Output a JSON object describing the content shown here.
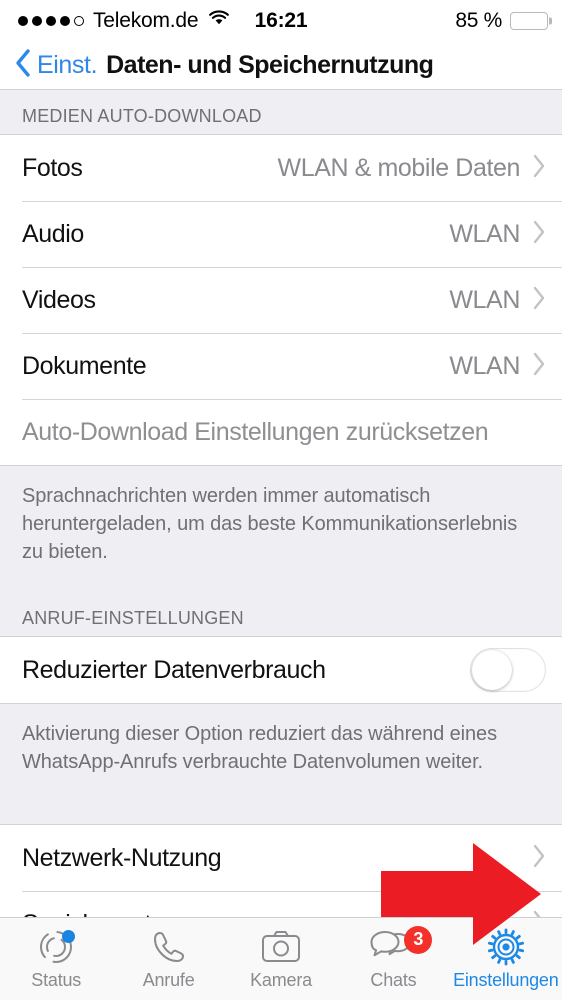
{
  "status_bar": {
    "carrier": "Telekom.de",
    "signal_dots_filled": 4,
    "signal_dots_total": 5,
    "wifi_icon": "wifi-icon",
    "time": "16:21",
    "battery_percent": "85 %",
    "battery_level": 85,
    "battery_color": "#fecb2e"
  },
  "nav": {
    "back_icon": "chevron-left-icon",
    "back_label": "Einst.",
    "title": "Daten- und Speichernutzung",
    "accent_color": "#2f87e8"
  },
  "sections": {
    "media": {
      "header": "MEDIEN AUTO-DOWNLOAD",
      "rows": [
        {
          "label": "Fotos",
          "value": "WLAN & mobile Daten"
        },
        {
          "label": "Audio",
          "value": "WLAN"
        },
        {
          "label": "Videos",
          "value": "WLAN"
        },
        {
          "label": "Dokumente",
          "value": "WLAN"
        }
      ],
      "reset_label": "Auto-Download Einstellungen zurücksetzen",
      "footer": "Sprachnachrichten werden immer automatisch heruntergeladen, um das beste Kommunikationserlebnis zu bieten."
    },
    "calls": {
      "header": "ANRUF-EINSTELLUNGEN",
      "toggle_label": "Reduzierter Datenverbrauch",
      "toggle_state": "off",
      "footer": "Aktivierung dieser Option reduziert das während eines WhatsApp-Anrufs verbrauchte Datenvolumen weiter."
    },
    "usage": {
      "rows": [
        {
          "label": "Netzwerk-Nutzung"
        },
        {
          "label": "Speichernutzung"
        }
      ]
    }
  },
  "annotation": {
    "arrow_color": "#ec1c24",
    "points_at": "Speichernutzung"
  },
  "tab_bar": {
    "tabs": [
      {
        "label": "Status",
        "icon": "status-rings-icon",
        "active": false,
        "dot": true
      },
      {
        "label": "Anrufe",
        "icon": "phone-icon",
        "active": false
      },
      {
        "label": "Kamera",
        "icon": "camera-icon",
        "active": false
      },
      {
        "label": "Chats",
        "icon": "chat-bubbles-icon",
        "active": false,
        "badge": "3"
      },
      {
        "label": "Einstellungen",
        "icon": "gear-icon",
        "active": true
      }
    ],
    "active_color": "#1e88e5",
    "badge_color": "#f4302a"
  }
}
